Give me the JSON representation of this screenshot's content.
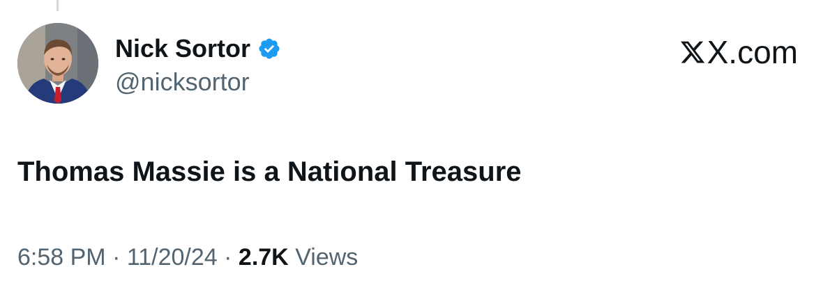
{
  "author": {
    "display_name": "Nick Sortor",
    "handle": "@nicksortor",
    "verified": true,
    "avatar_icon": "profile-photo"
  },
  "brand": {
    "label": "X.com",
    "icon": "x-logo-icon"
  },
  "tweet": {
    "text": "Thomas Massie is a National Treasure"
  },
  "meta": {
    "time": "6:58 PM",
    "separator": "·",
    "date": "11/20/24",
    "views_count": "2.7K",
    "views_label": "Views"
  },
  "colors": {
    "text_primary": "#0f1419",
    "text_secondary": "#536471",
    "verified_blue": "#1d9bf0",
    "thread_line": "#cfd9de"
  }
}
